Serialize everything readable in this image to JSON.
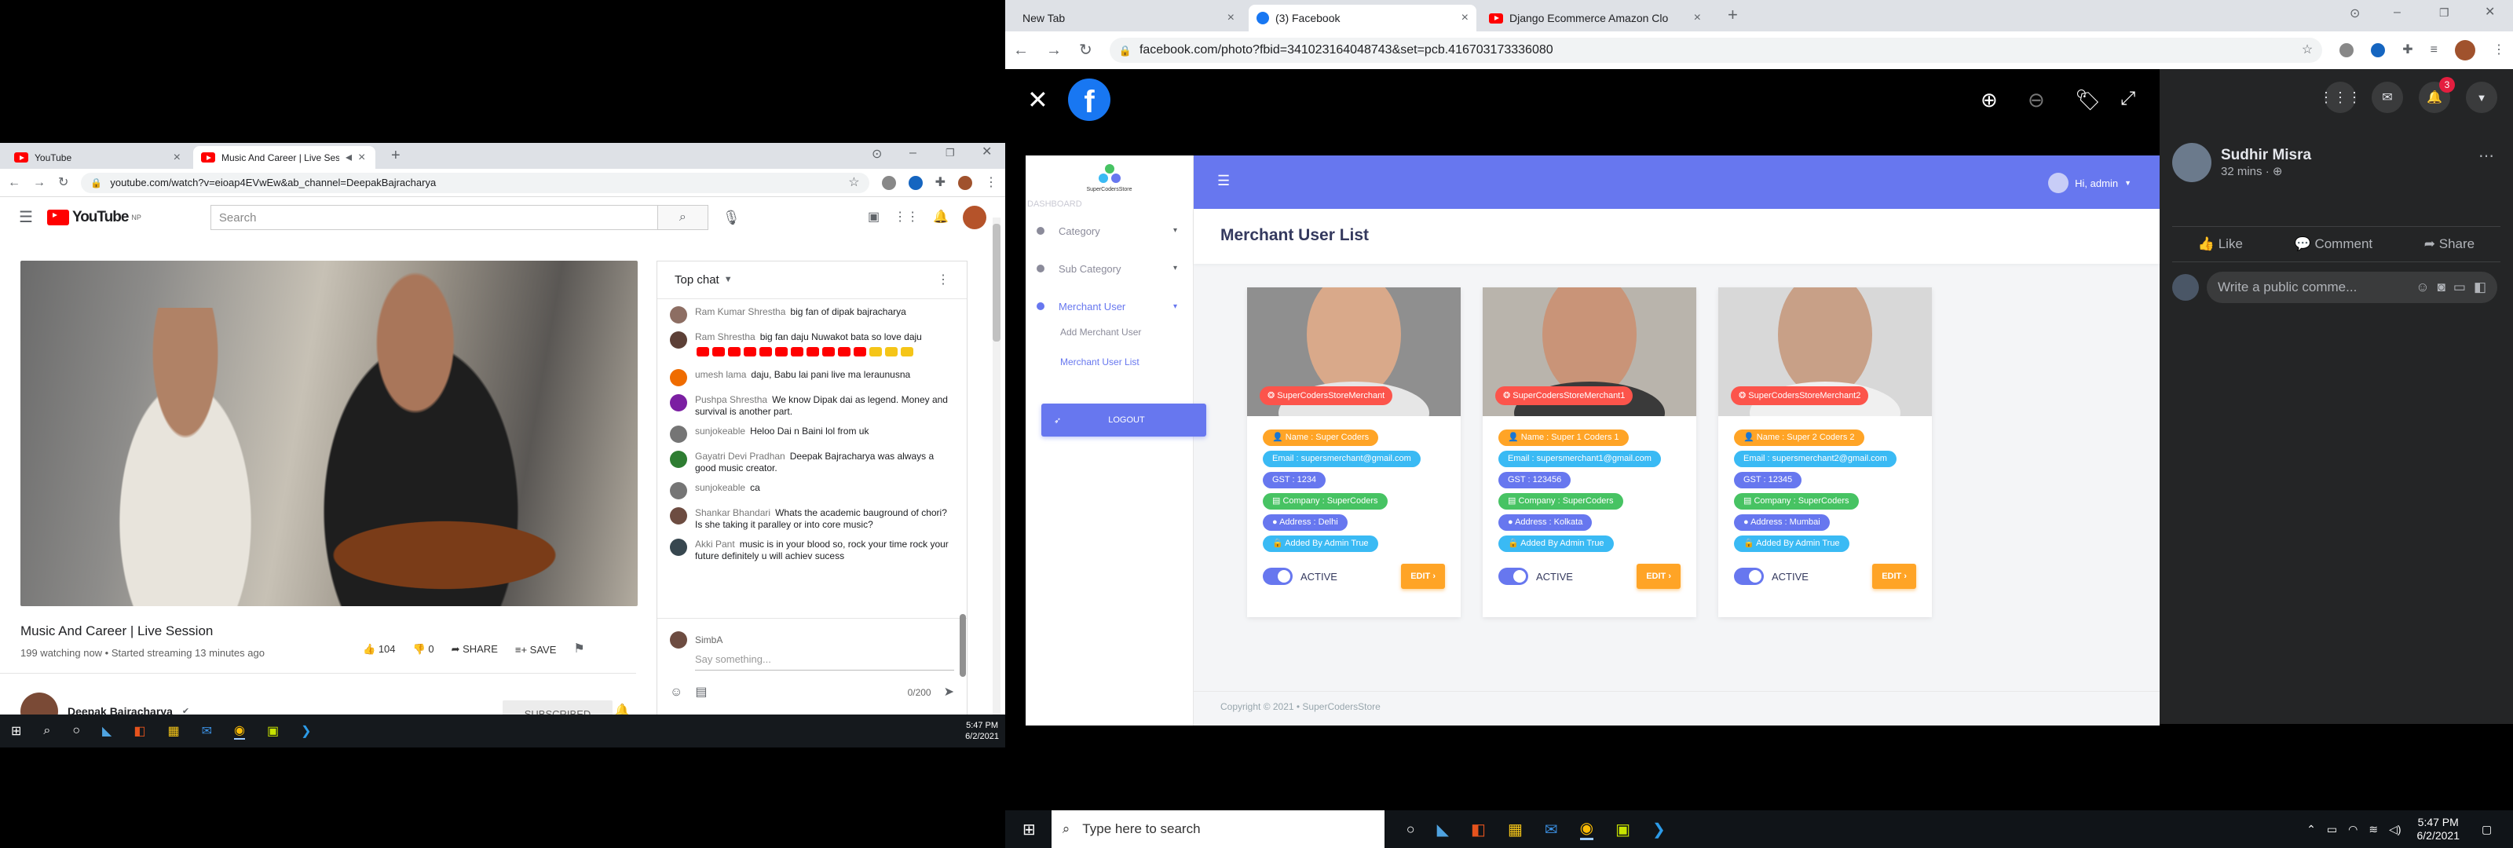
{
  "left": {
    "tabs": [
      "YouTube",
      "Music And Career | Live Session"
    ],
    "url": "youtube.com/watch?v=eioap4EVwEw&ab_channel=DeepakBajracharya",
    "youtube": {
      "logo_text": "YouTube",
      "region": "NP",
      "search_placeholder": "Search",
      "video_title": "Music And Career | Live Session",
      "watching": "199 watching now • Started streaming 13 minutes ago",
      "likes": "104",
      "dislikes": "0",
      "share": "SHARE",
      "save": "SAVE",
      "channel": "Deepak Bajracharya",
      "subscribed": "SUBSCRIBED"
    },
    "chat": {
      "header": "Top chat",
      "messages": [
        {
          "name": "Ram Kumar Shrestha",
          "text": "big fan of dipak bajracharya",
          "color": "#8d6e63"
        },
        {
          "name": "Ram Shrestha",
          "text": "big fan daju Nuwakot bata so love daju",
          "color": "#5d4037"
        },
        {
          "name": "umesh lama",
          "text": "daju, Babu lai pani live ma leraunusna",
          "color": "#ef6c00"
        },
        {
          "name": "Pushpa Shrestha",
          "text": "We know Dipak dai as legend. Money and survival is another part.",
          "color": "#7b1fa2"
        },
        {
          "name": "sunjokeable",
          "text": "Heloo Dai n Baini lol from uk",
          "color": "#757575"
        },
        {
          "name": "Gayatri Devi Pradhan",
          "text": "Deepak Bajracharya was always a good music creator.",
          "color": "#2e7d32"
        },
        {
          "name": "sunjokeable",
          "text": "ca",
          "color": "#757575"
        },
        {
          "name": "Shankar Bhandari",
          "text": "Whats the academic bauground of chori? Is she taking it paralley or into core music?",
          "color": "#6d4c41"
        },
        {
          "name": "Akki Pant",
          "text": "music is in your blood so, rock your time rock your future definitely u will achiev sucess",
          "color": "#37474f"
        }
      ],
      "user": "SimbA",
      "input_placeholder": "Say something...",
      "counter": "0/200"
    },
    "taskbar_time": "5:47 PM",
    "taskbar_date": "6/2/2021"
  },
  "right": {
    "tabs": [
      "New Tab",
      "(3) Facebook",
      "Django Ecommerce Amazon Clo"
    ],
    "url": "facebook.com/photo?fbid=341023164048743&set=pcb.416703173336080",
    "dashboard": {
      "brand": "SuperCodersStore",
      "section": "DASHBOARD",
      "nav": [
        "Category",
        "Sub Category",
        "Merchant User"
      ],
      "subnav": [
        "Add Merchant User",
        "Merchant User List"
      ],
      "logout": "LOGOUT",
      "greeting": "Hi, admin",
      "page_title": "Merchant User List",
      "merchants": [
        {
          "badge": "SuperCodersStoreMerchant",
          "name": "Name : Super Coders",
          "email": "Email : supersmerchant@gmail.com",
          "gst": "GST : 1234",
          "company": "Company : SuperCoders",
          "address": "Address : Delhi",
          "added": "Added By Admin True",
          "status": "ACTIVE",
          "edit": "EDIT"
        },
        {
          "badge": "SuperCodersStoreMerchant1",
          "name": "Name : Super 1 Coders 1",
          "email": "Email : supersmerchant1@gmail.com",
          "gst": "GST : 123456",
          "company": "Company : SuperCoders",
          "address": "Address : Kolkata",
          "added": "Added By Admin True",
          "status": "ACTIVE",
          "edit": "EDIT"
        },
        {
          "badge": "SuperCodersStoreMerchant2",
          "name": "Name : Super 2 Coders 2",
          "email": "Email : supersmerchant2@gmail.com",
          "gst": "GST : 12345",
          "company": "Company : SuperCoders",
          "address": "Address : Mumbai",
          "added": "Added By Admin True",
          "status": "ACTIVE",
          "edit": "EDIT"
        }
      ],
      "footer": "Copyright © 2021  •  SuperCodersStore"
    },
    "facebook": {
      "notif_count": "3",
      "poster": "Sudhir Misra",
      "time": "32 mins · ",
      "like": "Like",
      "comment": "Comment",
      "share": "Share",
      "comment_placeholder": "Write a public comme..."
    },
    "taskbar_search": "Type here to search",
    "taskbar_time": "5:47 PM",
    "taskbar_date": "6/2/2021"
  },
  "colors": {
    "youtube_red": "#ff0000",
    "dashboard_primary": "#6777ef",
    "pill_yellow": "#ffa426",
    "pill_cyan": "#3abaf4",
    "pill_green": "#47c363",
    "badge_red": "#fc544b",
    "facebook_blue": "#1877f2"
  }
}
